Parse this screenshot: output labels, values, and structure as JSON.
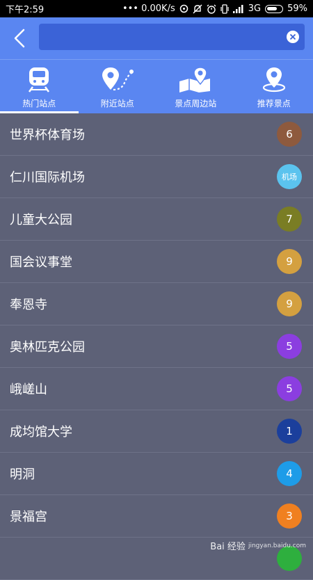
{
  "status_bar": {
    "time": "下午2:59",
    "network_speed": "••• 0.00K/s",
    "signal_type": "3G",
    "battery": "59%"
  },
  "header": {
    "back_icon": "back-arrow-icon",
    "search": {
      "value": "",
      "placeholder": ""
    },
    "clear_icon": "clear-x-icon"
  },
  "tabs": [
    {
      "label": "热门站点",
      "icon": "train-icon",
      "active": true
    },
    {
      "label": "附近站点",
      "icon": "location-route-icon",
      "active": false
    },
    {
      "label": "景点周边站",
      "icon": "map-pin-icon",
      "active": false
    },
    {
      "label": "推荐景点",
      "icon": "location-target-icon",
      "active": false
    }
  ],
  "stations": [
    {
      "name": "世界杯体育场",
      "line": "6",
      "color": "#8e5a3e"
    },
    {
      "name": "仁川国际机场",
      "line": "机场",
      "color": "#5bc3ee"
    },
    {
      "name": "儿童大公园",
      "line": "7",
      "color": "#7a7d24"
    },
    {
      "name": "国会议事堂",
      "line": "9",
      "color": "#d4a040"
    },
    {
      "name": "奉恩寺",
      "line": "9",
      "color": "#d4a040"
    },
    {
      "name": "奥林匹克公园",
      "line": "5",
      "color": "#8b3ee0"
    },
    {
      "name": "峨嵯山",
      "line": "5",
      "color": "#8b3ee0"
    },
    {
      "name": "成均馆大学",
      "line": "1",
      "color": "#1b3f9c"
    },
    {
      "name": "明洞",
      "line": "4",
      "color": "#1e9ce8"
    },
    {
      "name": "景福宫",
      "line": "3",
      "color": "#f08020"
    },
    {
      "name": "",
      "line": "",
      "color": "#2eaf3e"
    }
  ],
  "watermark": {
    "text": "Bai 经验",
    "sub": "jingyan.baidu.com"
  }
}
